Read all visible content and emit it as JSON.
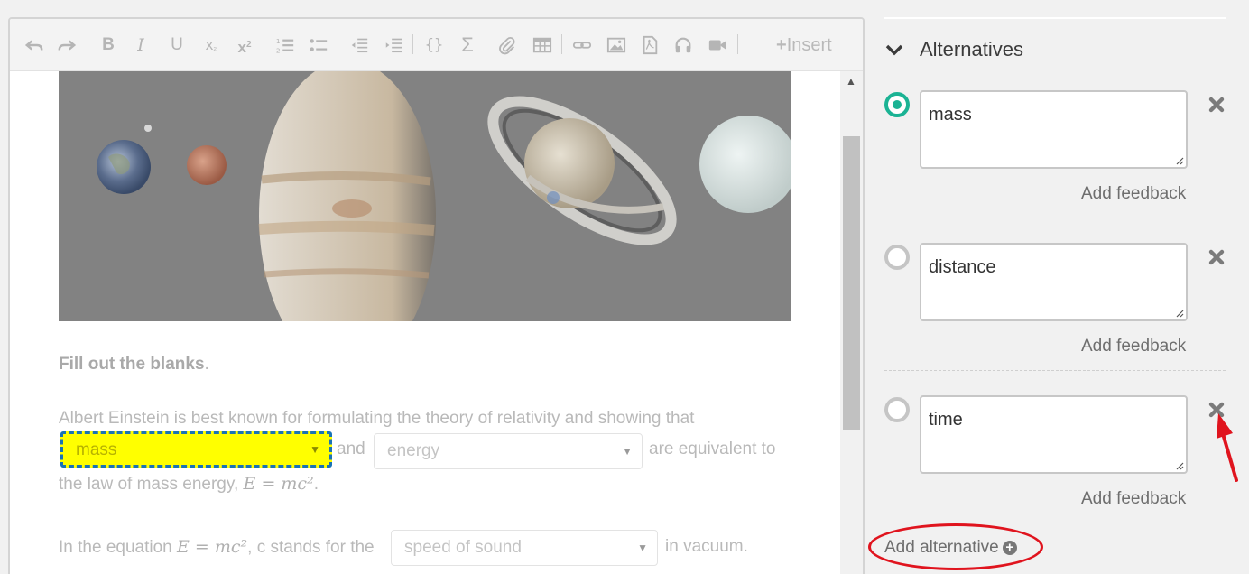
{
  "toolbar": {
    "insert_label": "Insert",
    "insert_icon": "plus"
  },
  "content": {
    "heading": "Fill out the blanks",
    "heading_suffix": ".",
    "sentence1_line1": "Albert Einstein is best known for formulating the theory of relativity and showing that",
    "sentence1_and": "and",
    "sentence1_after": "are equivalent to",
    "sentence1_line3_prefix": "the law of mass energy,",
    "equation": "E = mc²",
    "period": ".",
    "sentence2_prefix": "In the equation",
    "sentence2_mid": ", c stands for the",
    "sentence2_suffix": "in vacuum.",
    "blank1_value": "mass",
    "blank2_value": "energy",
    "blank3_value": "speed of sound"
  },
  "panel": {
    "section_title": "Alternatives",
    "alternatives": [
      {
        "value": "mass",
        "checked": true,
        "feedback_label": "Add feedback"
      },
      {
        "value": "distance",
        "checked": false,
        "feedback_label": "Add feedback"
      },
      {
        "value": "time",
        "checked": false,
        "feedback_label": "Add feedback"
      }
    ],
    "add_alternative_label": "Add alternative"
  },
  "colors": {
    "accent_green": "#1bb394",
    "highlight_yellow": "#ffff00",
    "annotation_red": "#e0141e",
    "blank_border_blue": "#1a73b5"
  }
}
